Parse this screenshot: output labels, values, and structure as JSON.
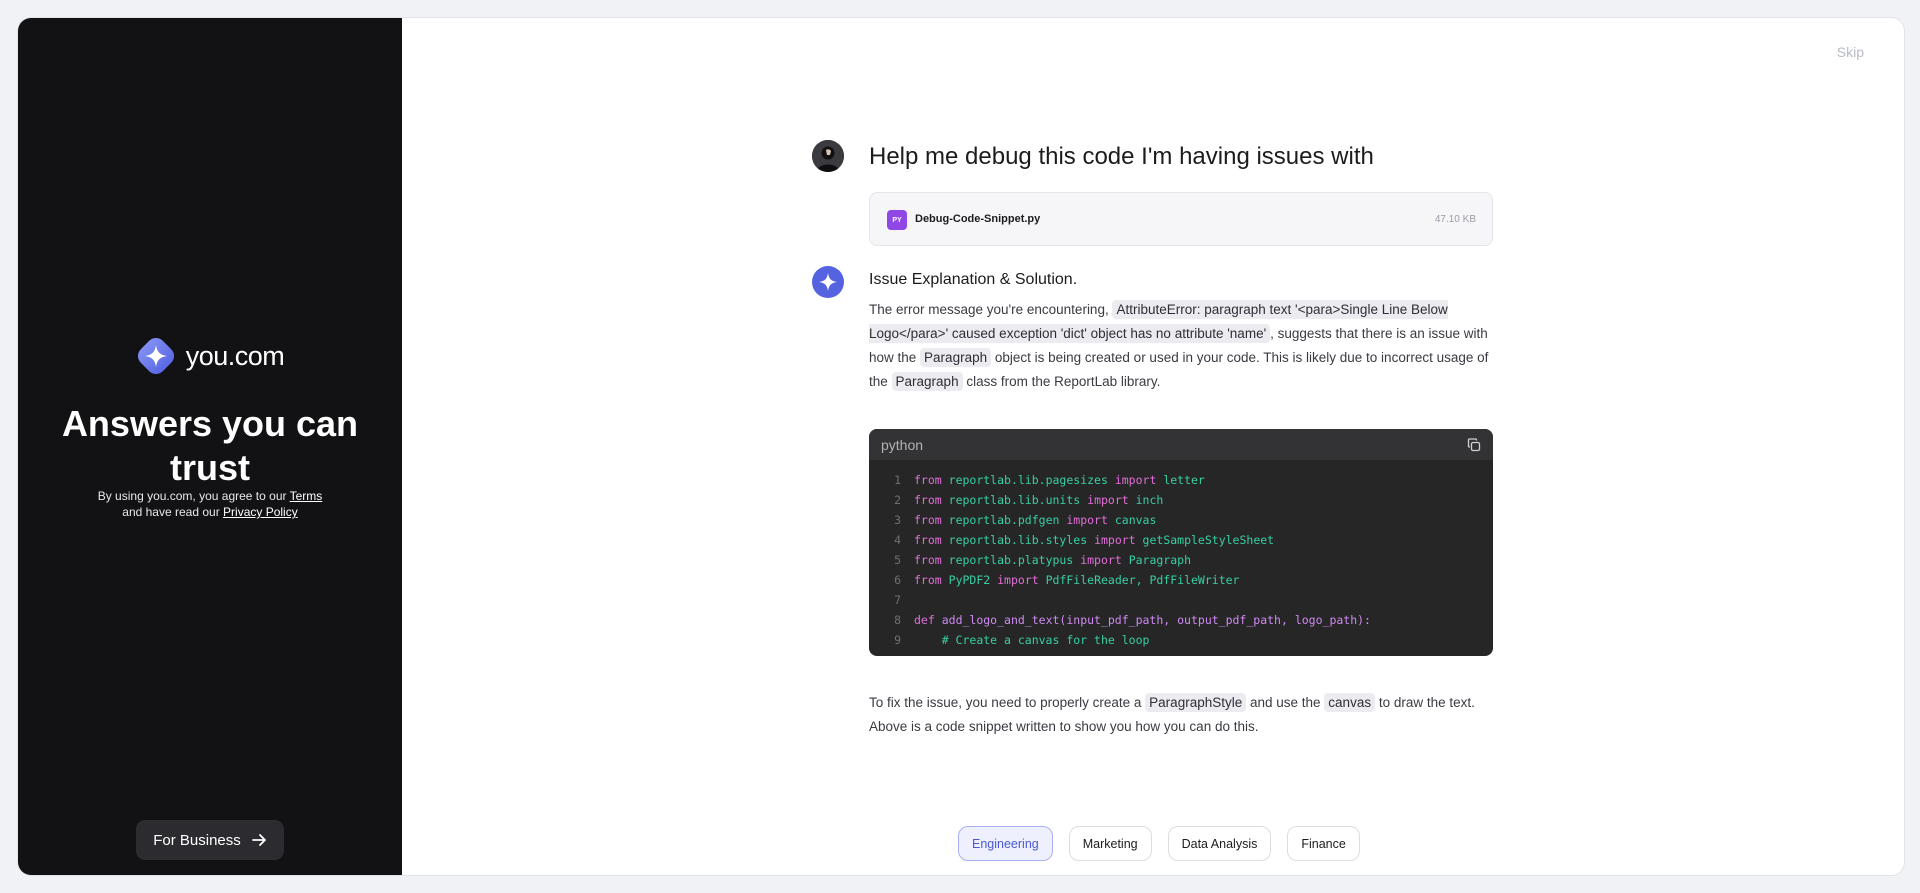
{
  "brand": {
    "name": "you.com"
  },
  "left_panel": {
    "tagline": "Answers you can trust",
    "legal_prefix_1": "By using you.com, you agree to our ",
    "terms_label": "Terms",
    "legal_prefix_2": "and have read our ",
    "privacy_label": "Privacy Policy",
    "business_button": "For Business"
  },
  "skip_label": "Skip",
  "conversation": {
    "question": "Help me debug this code I'm having issues with",
    "file": {
      "badge": "PY",
      "name": "Debug-Code-Snippet.py",
      "size": "47.10 KB"
    },
    "answer_title": "Issue Explanation & Solution.",
    "p1": {
      "t1": "The error message you're encountering, ",
      "c1": "AttributeError: paragraph text '<para>Single Line Below Logo</para>' caused exception 'dict' object has no attribute 'name'",
      "t2": ", suggests that there is an issue with how the ",
      "c2": "Paragraph",
      "t3": " object is being created or used in your code. This is likely due to incorrect usage of the ",
      "c3": "Paragraph",
      "t4": " class from the ReportLab library."
    },
    "code": {
      "language": "python",
      "lines": [
        {
          "n": "1",
          "parts": [
            [
              "kw",
              "from"
            ],
            [
              "pl",
              " "
            ],
            [
              "mod",
              "reportlab.lib.pagesizes"
            ],
            [
              "pl",
              " "
            ],
            [
              "kw",
              "import"
            ],
            [
              "pl",
              " "
            ],
            [
              "mod",
              "letter"
            ]
          ]
        },
        {
          "n": "2",
          "parts": [
            [
              "kw",
              "from"
            ],
            [
              "pl",
              " "
            ],
            [
              "mod",
              "reportlab.lib.units"
            ],
            [
              "pl",
              " "
            ],
            [
              "kw",
              "import"
            ],
            [
              "pl",
              " "
            ],
            [
              "mod",
              "inch"
            ]
          ]
        },
        {
          "n": "3",
          "parts": [
            [
              "kw",
              "from"
            ],
            [
              "pl",
              " "
            ],
            [
              "mod",
              "reportlab.pdfgen"
            ],
            [
              "pl",
              " "
            ],
            [
              "kw",
              "import"
            ],
            [
              "pl",
              " "
            ],
            [
              "mod",
              "canvas"
            ]
          ]
        },
        {
          "n": "4",
          "parts": [
            [
              "kw",
              "from"
            ],
            [
              "pl",
              " "
            ],
            [
              "mod",
              "reportlab.lib.styles"
            ],
            [
              "pl",
              " "
            ],
            [
              "kw",
              "import"
            ],
            [
              "pl",
              " "
            ],
            [
              "mod",
              "getSampleStyleSheet"
            ]
          ]
        },
        {
          "n": "5",
          "parts": [
            [
              "kw",
              "from"
            ],
            [
              "pl",
              " "
            ],
            [
              "mod",
              "reportlab.platypus"
            ],
            [
              "pl",
              " "
            ],
            [
              "kw",
              "import"
            ],
            [
              "pl",
              " "
            ],
            [
              "mod",
              "Paragraph"
            ]
          ]
        },
        {
          "n": "6",
          "parts": [
            [
              "kw",
              "from"
            ],
            [
              "pl",
              " "
            ],
            [
              "mod",
              "PyPDF2"
            ],
            [
              "pl",
              " "
            ],
            [
              "kw",
              "import"
            ],
            [
              "pl",
              " "
            ],
            [
              "mod",
              "PdfFileReader, PdfFileWriter"
            ]
          ]
        },
        {
          "n": "7",
          "parts": []
        },
        {
          "n": "8",
          "parts": [
            [
              "kw",
              "def"
            ],
            [
              "pl",
              " "
            ],
            [
              "fn",
              "add_logo_and_text(input_pdf_path, output_pdf_path, logo_path):"
            ]
          ]
        },
        {
          "n": "9",
          "parts": [
            [
              "pl",
              "    "
            ],
            [
              "cm",
              "# Create a canvas for the loop"
            ]
          ]
        }
      ]
    },
    "p2": {
      "t1": "To fix the issue, you need to properly create a ",
      "c1": "ParagraphStyle",
      "t2": " and use the ",
      "c2": "canvas",
      "t3": " to draw the text. Above is a code snippet written to show you how you can do this."
    }
  },
  "chips": [
    "Engineering",
    "Marketing",
    "Data Analysis",
    "Finance"
  ],
  "active_chip": "Engineering",
  "colors": {
    "accent": "#5563e0",
    "left_bg": "#121214",
    "file_badge": "#8f47e6"
  }
}
